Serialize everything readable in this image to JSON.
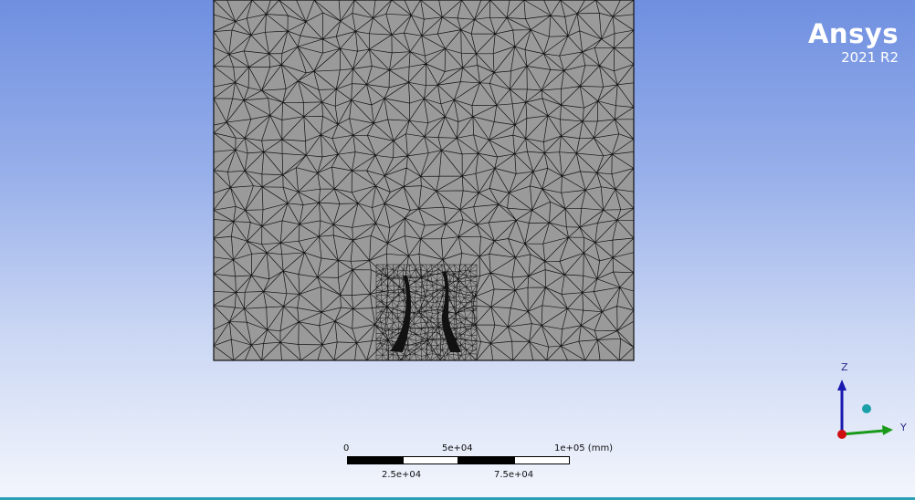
{
  "brand": {
    "name": "Ansys",
    "version": "2021 R2"
  },
  "scale": {
    "top_labels": [
      "0",
      "5e+04",
      "1e+05 (mm)"
    ],
    "bottom_labels": [
      "2.5e+04",
      "7.5e+04"
    ]
  },
  "triad": {
    "z_label": "Z",
    "y_label": "Y"
  },
  "colors": {
    "mesh_fill": "#9a9a9a",
    "mesh_line": "#111111",
    "accent_bar": "#2a9fb5",
    "z_axis": "#1a1ab0",
    "y_axis": "#1a9a1a",
    "origin": "#d01010",
    "iso_ball": "#1aa0a8"
  }
}
